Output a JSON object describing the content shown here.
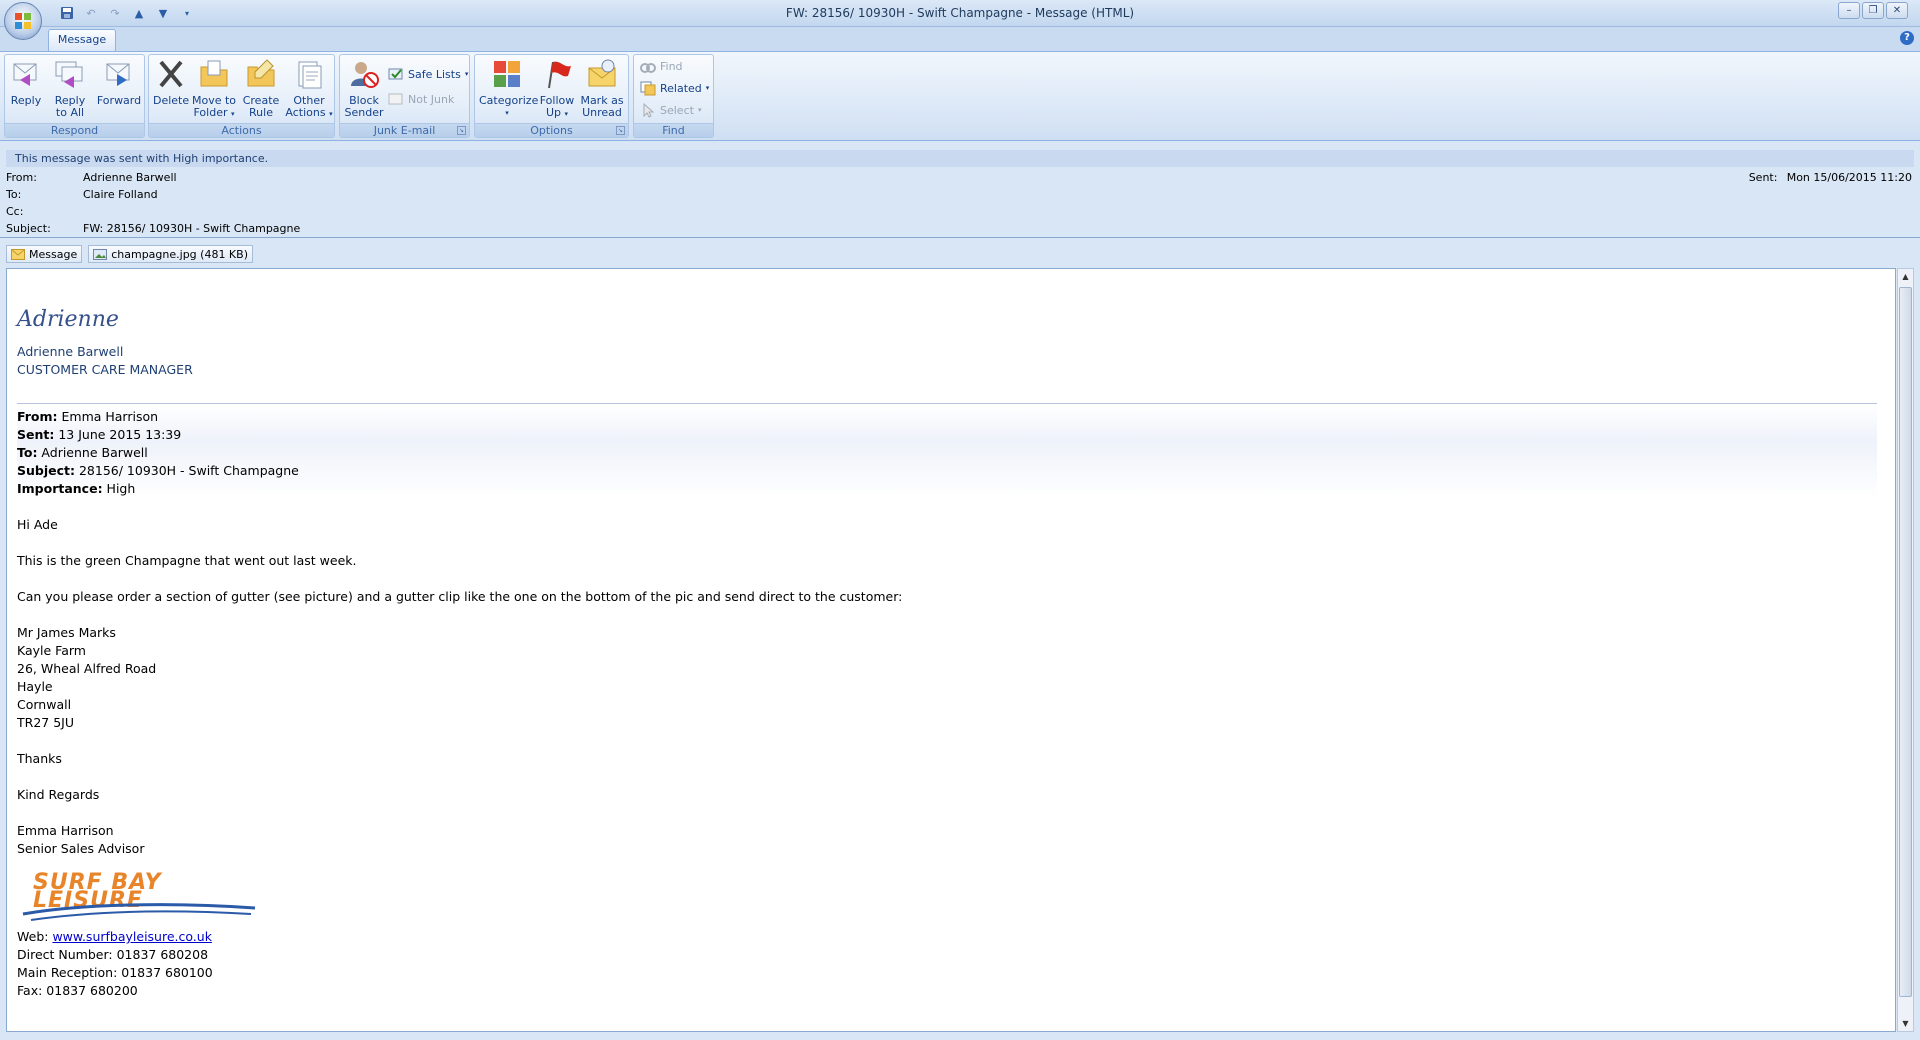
{
  "window": {
    "title": "FW: 28156/ 10930H - Swift Champagne - Message (HTML)",
    "controls": [
      "minimize",
      "restore",
      "close"
    ]
  },
  "quick_access": [
    "save-icon",
    "undo-icon",
    "redo-icon",
    "previous-item-icon",
    "next-item-icon",
    "customize-icon"
  ],
  "tabs": {
    "message": "Message"
  },
  "ribbon": {
    "respond": {
      "label": "Respond",
      "reply": "Reply",
      "reply_all_1": "Reply",
      "reply_all_2": "to All",
      "forward": "Forward"
    },
    "actions": {
      "label": "Actions",
      "delete": "Delete",
      "move_1": "Move to",
      "move_2": "Folder",
      "create_1": "Create",
      "create_2": "Rule",
      "other_1": "Other",
      "other_2": "Actions"
    },
    "junk": {
      "label": "Junk E-mail",
      "block_1": "Block",
      "block_2": "Sender",
      "safe_lists": "Safe Lists",
      "not_junk": "Not Junk"
    },
    "options": {
      "label": "Options",
      "categorize": "Categorize",
      "follow_1": "Follow",
      "follow_2": "Up",
      "mark_1": "Mark as",
      "mark_2": "Unread"
    },
    "find": {
      "label": "Find",
      "find": "Find",
      "related": "Related",
      "select": "Select"
    }
  },
  "infobar": "This message was sent with High importance.",
  "header": {
    "from_label": "From:",
    "from": "Adrienne Barwell",
    "to_label": "To:",
    "to": "Claire Folland",
    "cc_label": "Cc:",
    "cc": "",
    "subject_label": "Subject:",
    "subject": "FW: 28156/ 10930H - Swift Champagne",
    "sent_label": "Sent:",
    "sent": "Mon 15/06/2015 11:20"
  },
  "attachments": {
    "message": "Message",
    "file": "champagne.jpg (481 KB)"
  },
  "body": {
    "signature_script": "Adrienne",
    "sig_name": "Adrienne Barwell",
    "sig_title": "CUSTOMER CARE MANAGER",
    "fwd_from_label": "From:",
    "fwd_from": " Emma Harrison",
    "fwd_sent_label": "Sent:",
    "fwd_sent": " 13 June 2015 13:39",
    "fwd_to_label": "To:",
    "fwd_to": " Adrienne Barwell",
    "fwd_subject_label": "Subject:",
    "fwd_subject": " 28156/ 10930H - Swift Champagne",
    "fwd_importance_label": "Importance:",
    "fwd_importance": " High",
    "greeting": "Hi Ade",
    "line1": "This is the green Champagne that went out last week.",
    "line2": "Can you please order a section of gutter (see picture) and a gutter clip like the one on the bottom of the pic and send direct to the customer:",
    "address": [
      "Mr James Marks",
      "Kayle Farm",
      "26, Wheal Alfred Road",
      "Hayle",
      "Cornwall",
      "TR27 5JU"
    ],
    "thanks": "Thanks",
    "regards": "Kind Regards",
    "sender_name": "Emma Harrison",
    "sender_title": "Senior Sales Advisor",
    "logo_text": "SURF BAY LEISURE",
    "web_label": "Web: ",
    "web_link": "www.surfbayleisure.co.uk",
    "direct": "Direct Number:  01837 680208",
    "reception": "Main Reception:  01837 680100",
    "fax": "Fax:  01837 680200"
  },
  "colors": {
    "accent": "#15428b",
    "ribbon_bg": "#dde9f7",
    "header_bg": "#d9e6f5",
    "logo_orange": "#e8842a",
    "logo_blue": "#2a5aa8"
  }
}
